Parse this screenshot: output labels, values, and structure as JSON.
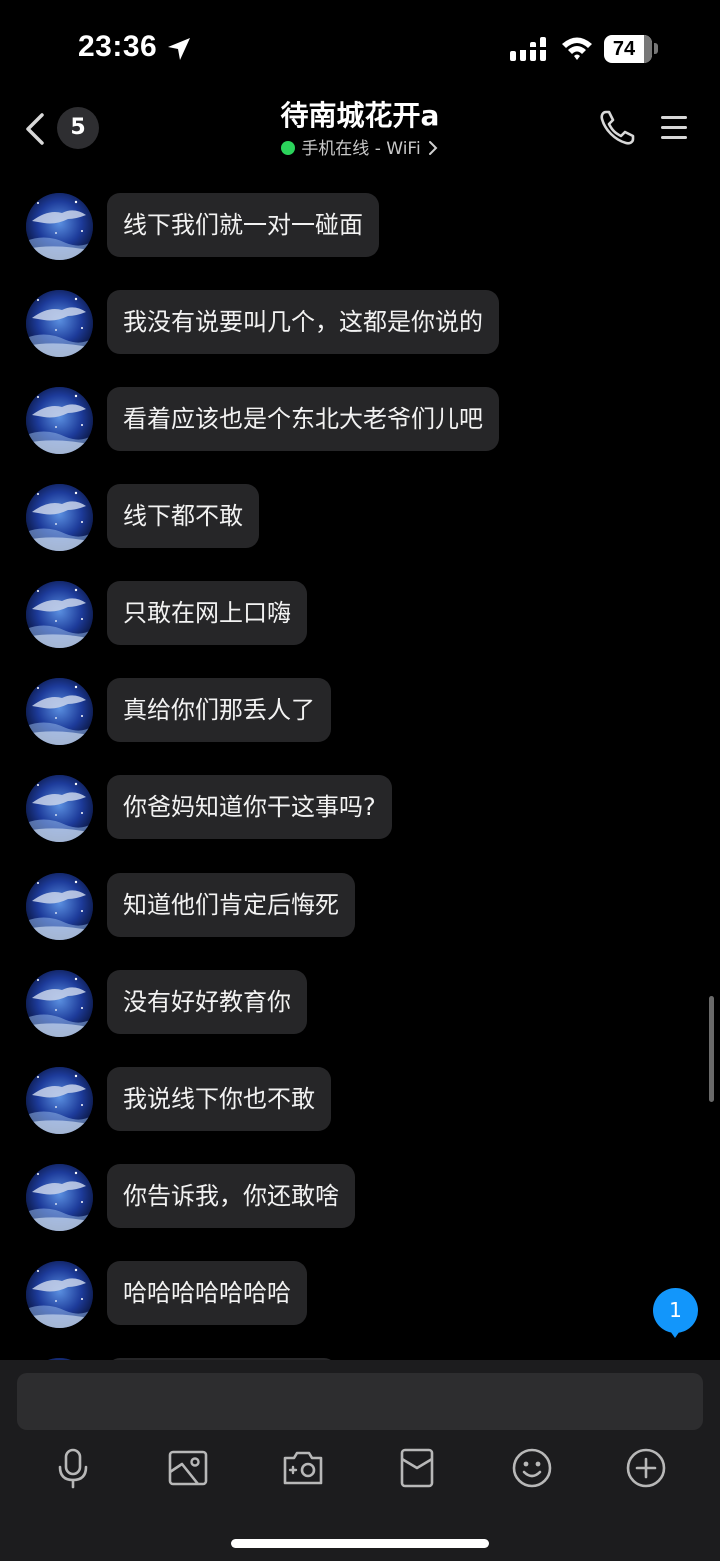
{
  "status_bar": {
    "time": "23:36",
    "battery": "74"
  },
  "header": {
    "unread_count": "5",
    "title": "待南城花开a",
    "status": "手机在线 - WiFi"
  },
  "messages": [
    {
      "text": "线下我们就一对一碰面"
    },
    {
      "text": "我没有说要叫几个，这都是你说的"
    },
    {
      "text": "看着应该也是个东北大老爷们儿吧"
    },
    {
      "text": "线下都不敢"
    },
    {
      "text": "只敢在网上口嗨"
    },
    {
      "text": "真给你们那丢人了"
    },
    {
      "text": "你爸妈知道你干这事吗?"
    },
    {
      "text": "知道他们肯定后悔死"
    },
    {
      "text": "没有好好教育你"
    },
    {
      "text": "我说线下你也不敢"
    },
    {
      "text": "你告诉我，你还敢啥"
    },
    {
      "text": "哈哈哈哈哈哈哈"
    }
  ],
  "new_message_badge": "1",
  "input": {
    "value": "",
    "placeholder": ""
  },
  "toolbar": {
    "icons": [
      "microphone-icon",
      "image-icon",
      "camera-icon",
      "red-envelope-icon",
      "emoji-icon",
      "plus-icon"
    ]
  },
  "colors": {
    "background": "#000000",
    "bubble": "#262628",
    "online": "#2bd35b",
    "badge": "#1296fb",
    "input_panel": "#1c1c1e"
  }
}
